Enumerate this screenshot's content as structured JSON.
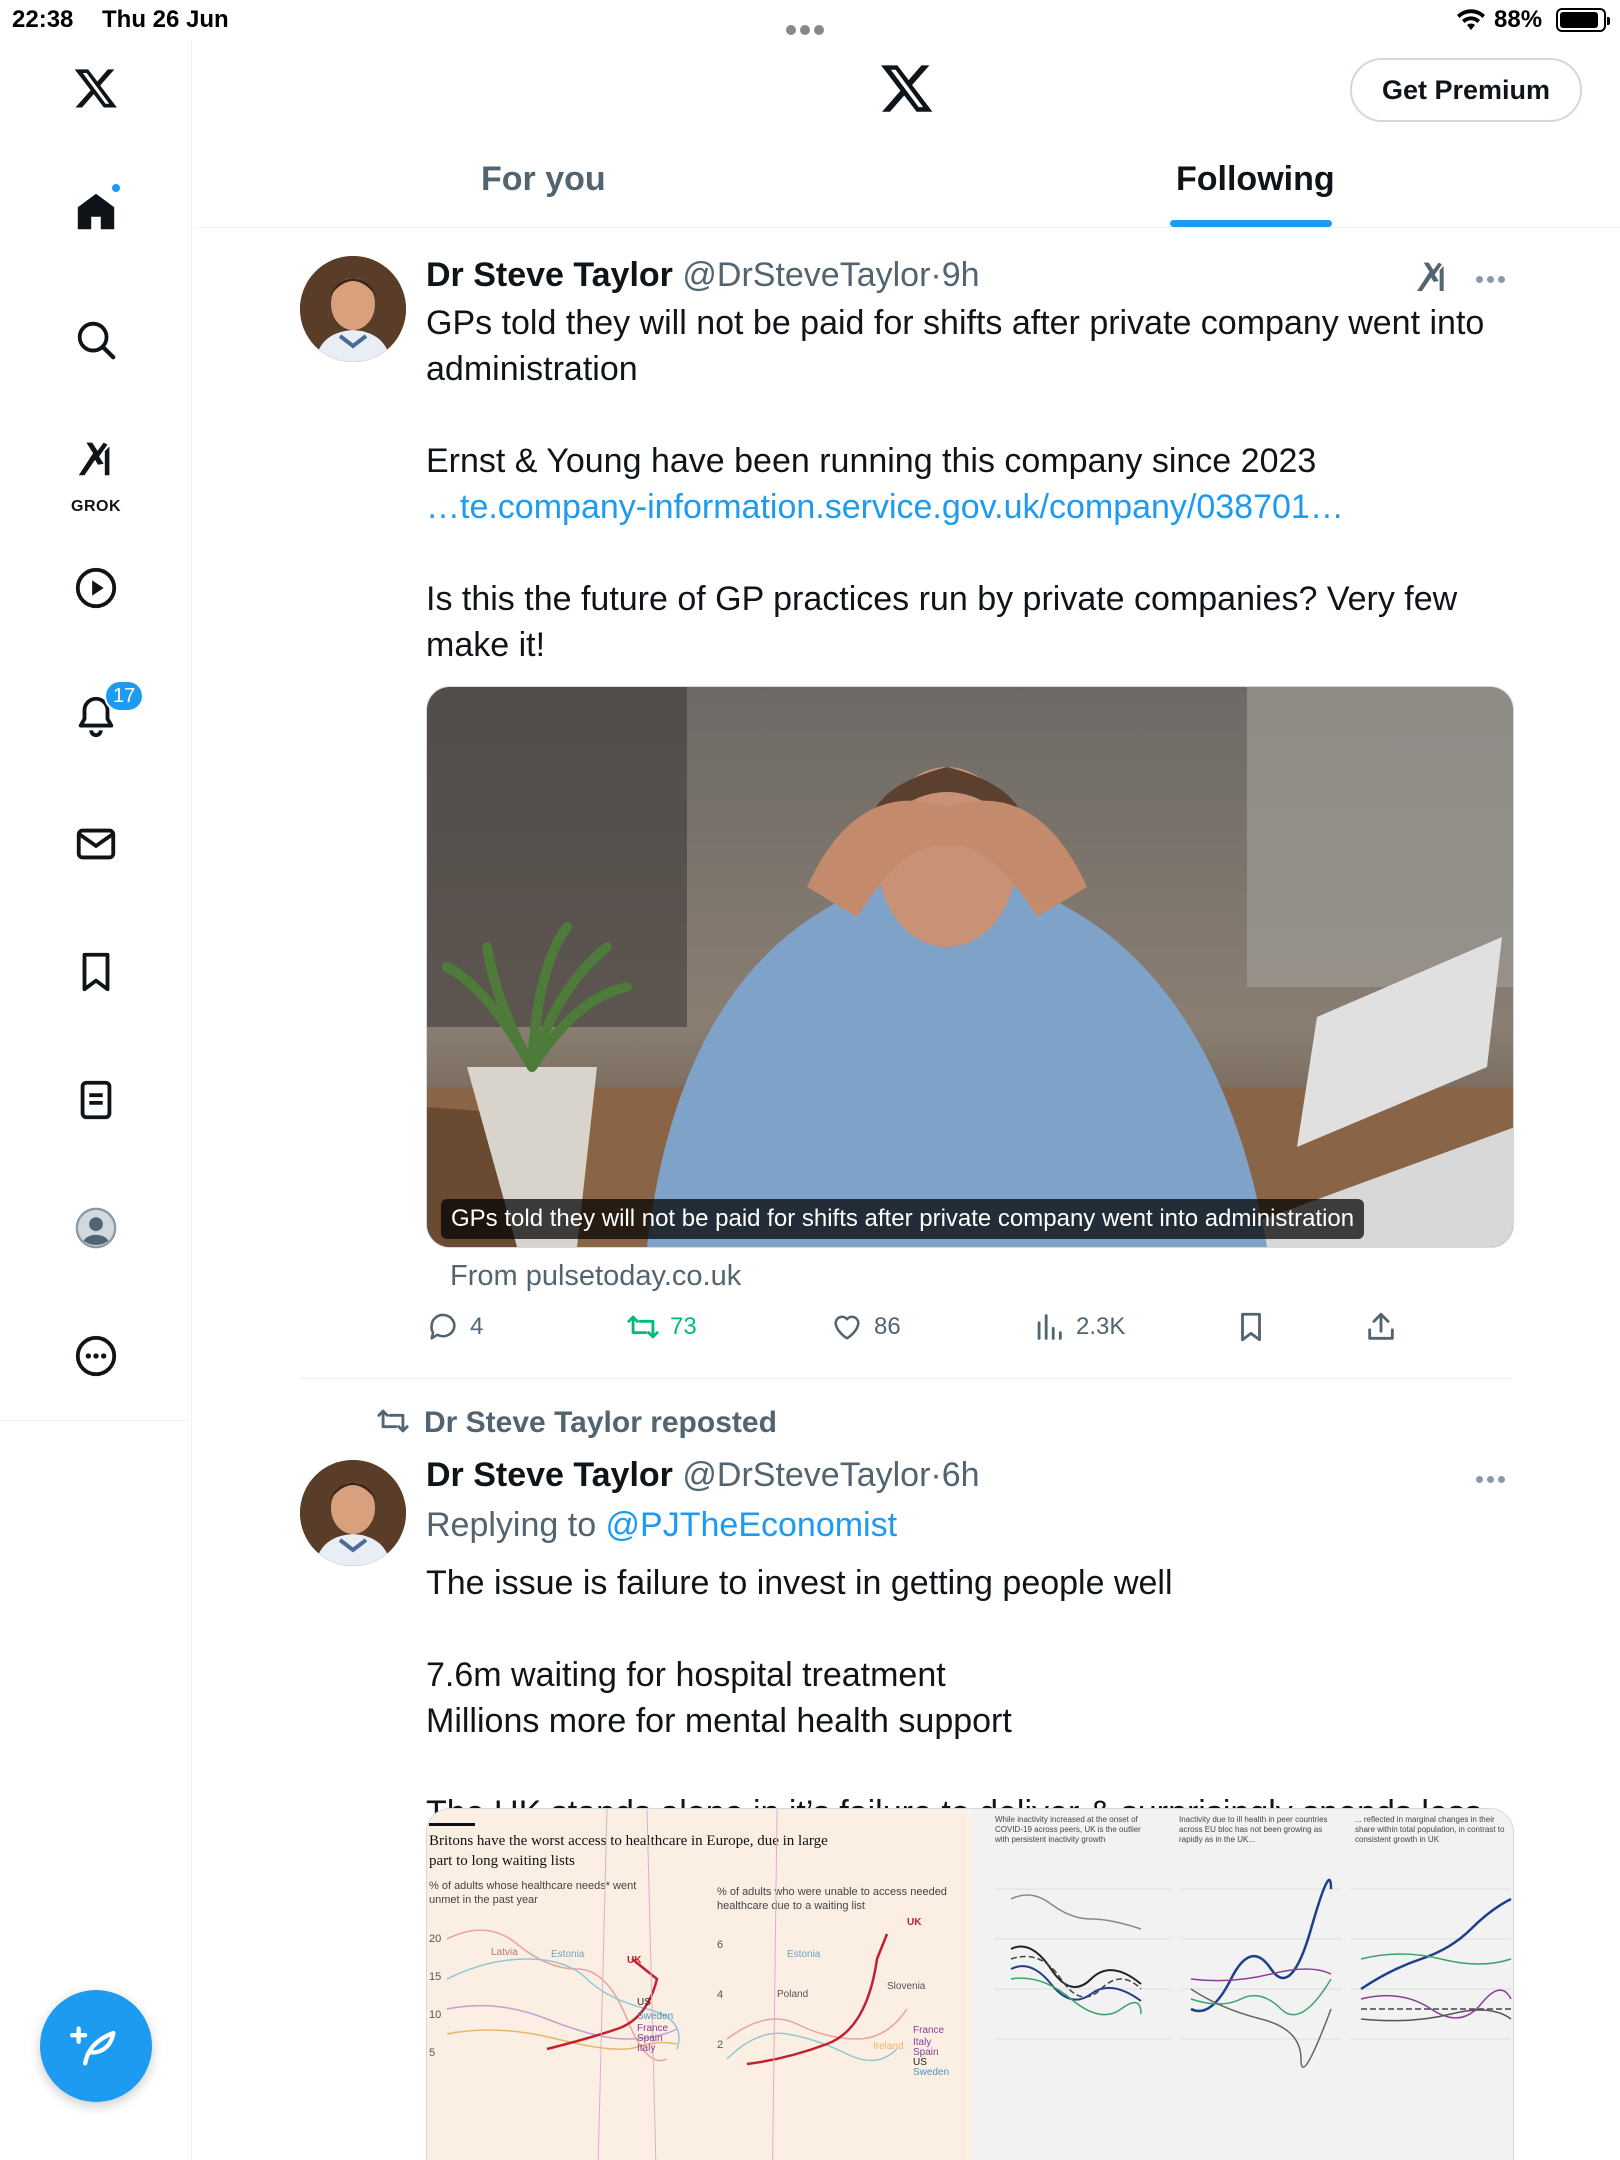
{
  "status_bar": {
    "time": "22:38",
    "date": "Thu 26 Jun",
    "battery": "88%"
  },
  "sidebar": {
    "items": [
      {
        "name": "x-logo-icon"
      },
      {
        "name": "home-icon"
      },
      {
        "name": "search-icon"
      },
      {
        "name": "grok-icon",
        "label": "GROK"
      },
      {
        "name": "video-icon"
      },
      {
        "name": "notifications-icon",
        "badge": "17"
      },
      {
        "name": "messages-icon"
      },
      {
        "name": "bookmarks-icon"
      },
      {
        "name": "lists-icon"
      },
      {
        "name": "profile-icon"
      },
      {
        "name": "more-icon"
      }
    ],
    "accent": "#1d9bf0"
  },
  "header": {
    "premium_button": "Get Premium",
    "tabs": [
      "For you",
      "Following"
    ],
    "active_tab": "Following"
  },
  "tweets": [
    {
      "name": "Dr Steve Taylor",
      "handle": "@DrSteveTaylor",
      "time": "9h",
      "text_1": "GPs told they will not be paid for shifts after private company went into administration\n\nErnst & Young have been running this company since 2023",
      "link": "…te.company-information.service.gov.uk/company/038701…",
      "text_2": "Is this the future of GP practices run by private companies? Very few make it!",
      "card_caption": "GPs told they will not be paid for shifts after private company went into administration",
      "card_source": "From pulsetoday.co.uk",
      "replies": "4",
      "reposts": "73",
      "likes": "86",
      "views": "2.3K"
    },
    {
      "repost_label": "Dr Steve Taylor reposted",
      "name": "Dr Steve Taylor",
      "handle": "@DrSteveTaylor",
      "time": "6h",
      "replying_prefix": "Replying to ",
      "replying_to": "@PJTheEconomist",
      "text": "The issue is failure to invest in getting people well\n\n7.6m waiting for hospital treatment\nMillions more for mental health support\n\nThe UK stands alone in it’s failure to deliver & surprisingly spends less than peer nations on support for those in need",
      "chart_image": {
        "title": "Britons have the worst access to healthcare in Europe, due in large part to long waiting lists",
        "left_sub": "% of adults whose healthcare needs* went unmet in the past year",
        "mid_sub": "% of adults who were unable to access needed healthcare due to a waiting list",
        "right_notes": [
          "While inactivity increased at the onset of COVID-19 across peers, UK is the outlier with persistent inactivity growth",
          "Inactivity due to ill health in peer countries across EU bloc has not been growing as rapidly as in the UK...",
          "... reflected in marginal changes in their share within total population, in contrast to consistent growth in UK"
        ],
        "left_ticks": [
          "20",
          "15",
          "10",
          "5"
        ],
        "mid_ticks": [
          "6",
          "4",
          "2"
        ],
        "labels_left": [
          "Latvia",
          "Estonia",
          "UK",
          "US",
          "Sweden",
          "France",
          "Spain",
          "Italy"
        ],
        "labels_mid": [
          "Estonia",
          "UK",
          "Poland",
          "Slovenia",
          "France",
          "Italy",
          "Spain",
          "US",
          "Ireland",
          "Sweden"
        ]
      }
    }
  ]
}
